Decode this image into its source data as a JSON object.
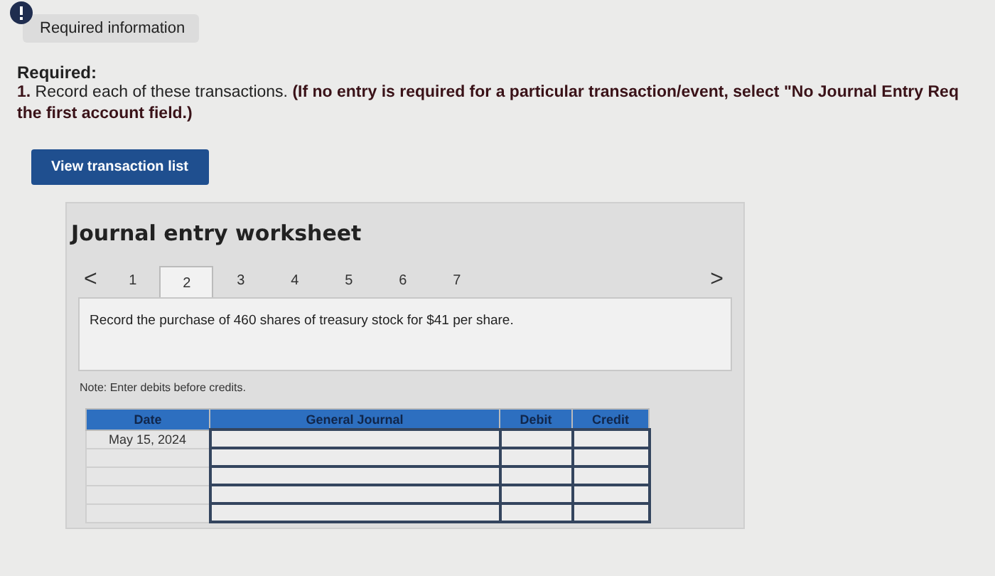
{
  "info_tab": {
    "label": "Required information"
  },
  "required": {
    "heading": "Required:",
    "text": "**1.** Record each of these transactions. **(If no entry is required for a particular transaction/event, select \"No Journal Entry Req the first account field.)**"
  },
  "view_button": "View transaction list",
  "worksheet": {
    "title": "Journal entry worksheet",
    "prev": "<",
    "next": ">",
    "tabs": [
      {
        "label": "1",
        "selected": false
      },
      {
        "label": "2",
        "selected": true
      },
      {
        "label": "3",
        "selected": false
      },
      {
        "label": "4",
        "selected": false
      },
      {
        "label": "5",
        "selected": false
      },
      {
        "label": "6",
        "selected": false
      },
      {
        "label": "7",
        "selected": false
      }
    ],
    "prompt": "Record the purchase of 460 shares of treasury stock for $41 per share.",
    "note": "Note: Enter debits before credits.",
    "table": {
      "columns": [
        "Date",
        "General Journal",
        "Debit",
        "Credit"
      ],
      "rows": [
        {
          "date": "May 15, 2024"
        },
        {},
        {},
        {},
        {}
      ]
    }
  }
}
